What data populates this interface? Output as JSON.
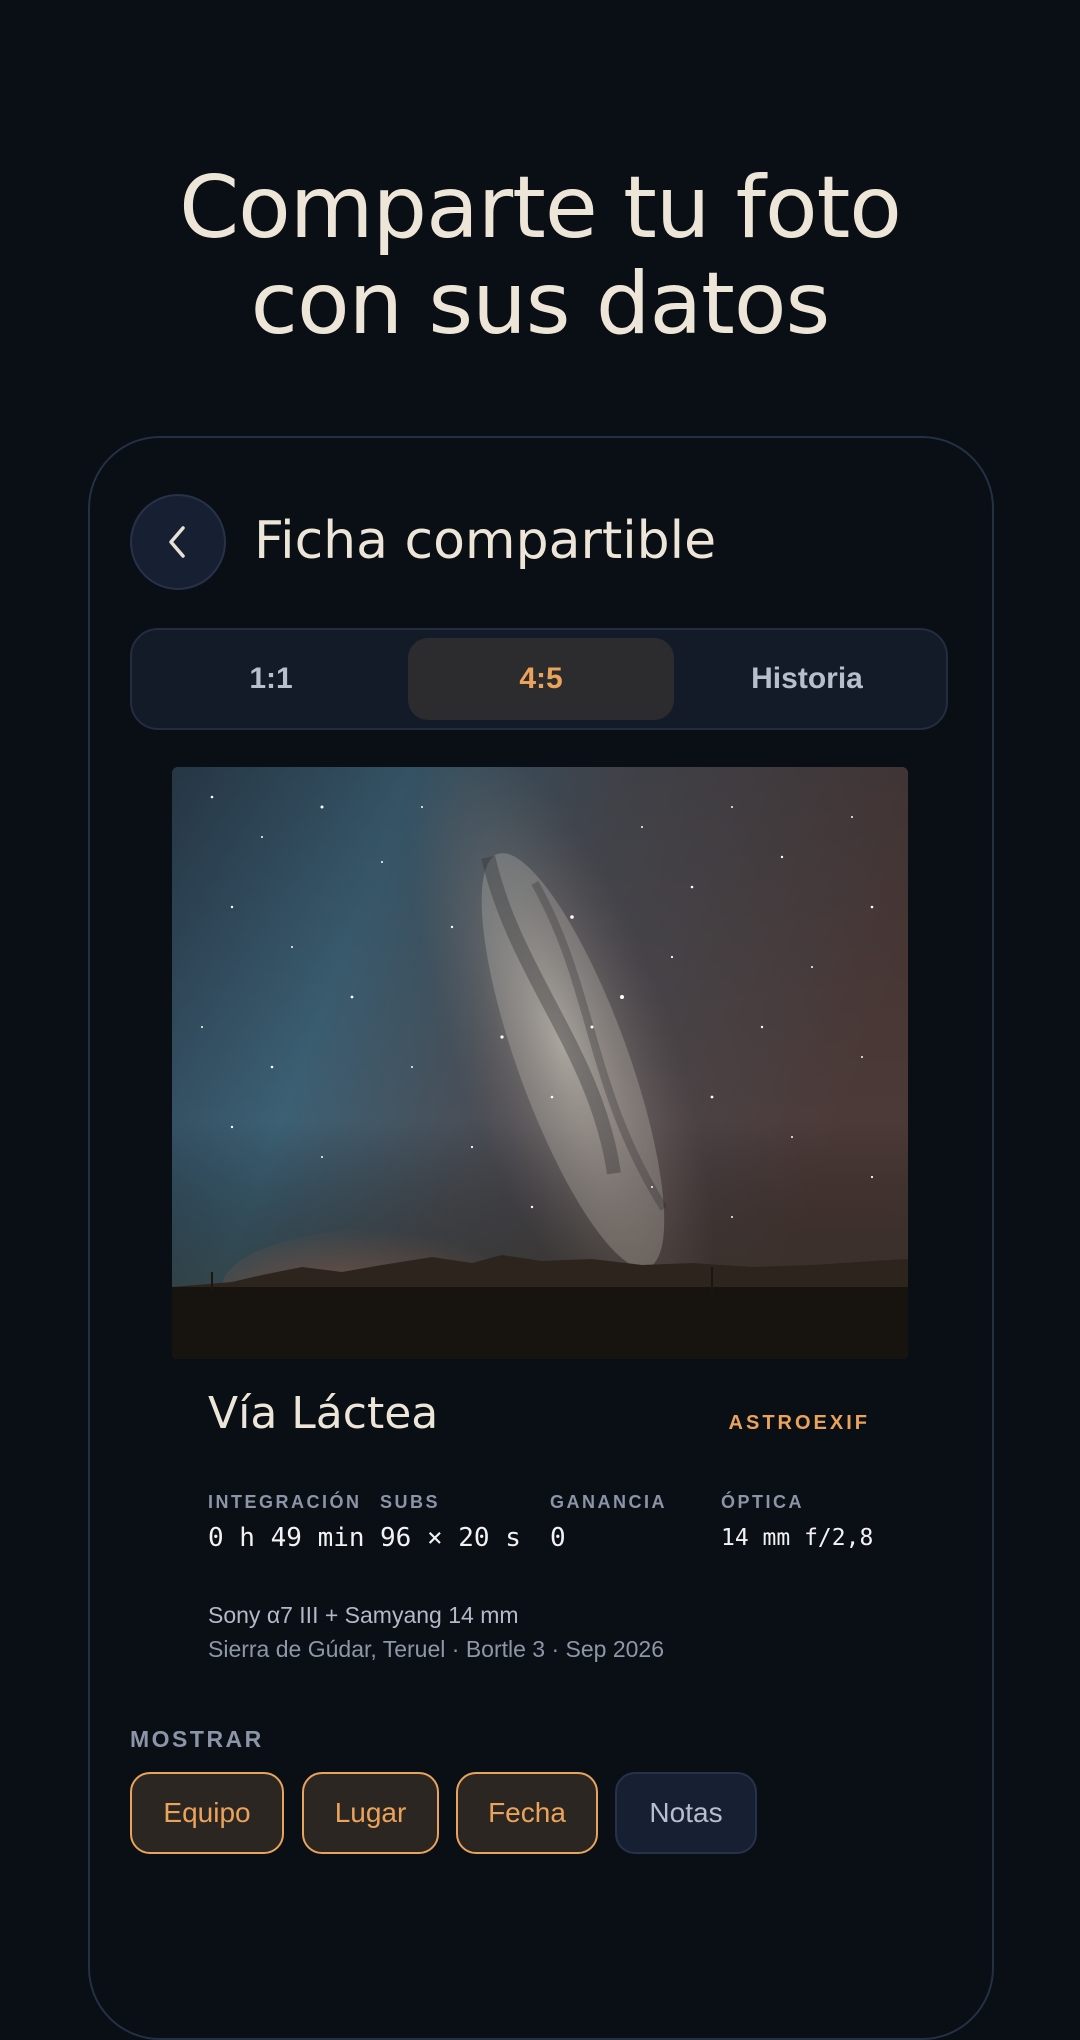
{
  "headline": {
    "line1": "Comparte tu foto",
    "line2": "con sus datos"
  },
  "screen": {
    "title": "Ficha compartible",
    "back_icon": "chevron-left-icon"
  },
  "format_tabs": {
    "items": [
      {
        "label": "1:1"
      },
      {
        "label": "4:5"
      },
      {
        "label": "Historia"
      }
    ],
    "selected": "4:5"
  },
  "card": {
    "object_name": "Vía Láctea",
    "brand": "ASTROEXIF",
    "stats": [
      {
        "label": "INTEGRACIÓN",
        "value": "0 h 49 min"
      },
      {
        "label": "SUBS",
        "value": "96 × 20 s"
      },
      {
        "label": "GANANCIA",
        "value": "0"
      },
      {
        "label": "ÓPTICA",
        "value": "14 mm f/2,8"
      }
    ],
    "equipment": "Sony α7 III + Samyang 14 mm",
    "location_line": "Sierra de Gúdar, Teruel · Bortle 3 · Sep 2026"
  },
  "show_section": {
    "label": "MOSTRAR",
    "chips": [
      {
        "label": "Equipo",
        "active": true
      },
      {
        "label": "Lugar",
        "active": true
      },
      {
        "label": "Fecha",
        "active": true
      },
      {
        "label": "Notas",
        "active": false
      }
    ]
  },
  "colors": {
    "background": "#0a0e15",
    "accent": "#eba35a",
    "text": "#ede6d8",
    "muted": "#8b95a7"
  }
}
